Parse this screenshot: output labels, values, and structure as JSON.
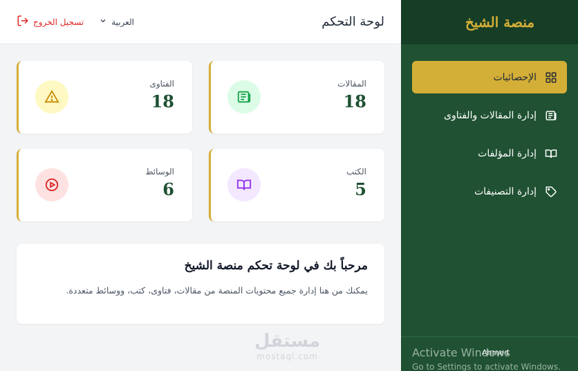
{
  "brand": "منصة الشيخ",
  "sidebar": {
    "items": [
      {
        "label": "الإحصائيات",
        "icon": "grid-icon",
        "active": true
      },
      {
        "label": "إدارة المقالات والفتاوى",
        "icon": "newspaper-icon",
        "active": false
      },
      {
        "label": "إدارة المؤلفات",
        "icon": "book-icon",
        "active": false
      },
      {
        "label": "إدارة التصنيفات",
        "icon": "tag-icon",
        "active": false
      }
    ],
    "footer_label": "Ahmed"
  },
  "header": {
    "title": "لوحة التحكم",
    "language": "العربية",
    "logout": "تسجيل الخروج"
  },
  "stats": {
    "articles": {
      "label": "المقالات",
      "value": "18",
      "icon": "newspaper-icon",
      "color": "#16a34a",
      "bg": "#dcfce7"
    },
    "fatwas": {
      "label": "الفتاوى",
      "value": "18",
      "icon": "warning-icon",
      "color": "#ca8a04",
      "bg": "#fef9c3"
    },
    "books": {
      "label": "الكتب",
      "value": "5",
      "icon": "book-icon",
      "color": "#9333ea",
      "bg": "#f3e8ff"
    },
    "media": {
      "label": "الوسائط",
      "value": "6",
      "icon": "play-circle-icon",
      "color": "#dc2626",
      "bg": "#fee2e2"
    }
  },
  "welcome": {
    "title": "مرحباً بك في لوحة تحكم منصة الشيخ",
    "text": "يمكنك من هنا إدارة جميع محتويات المنصة من مقالات، فتاوى، كتب، ووسائط متعددة."
  },
  "watermark": {
    "arabic": "مستقل",
    "latin": "mostaql.com"
  },
  "overlay": {
    "line1": "Activate Windows",
    "line2": "Go to Settings to activate Windows."
  },
  "colors": {
    "primary": "#1f5132",
    "accent": "#d4af37",
    "danger": "#dc2626"
  }
}
